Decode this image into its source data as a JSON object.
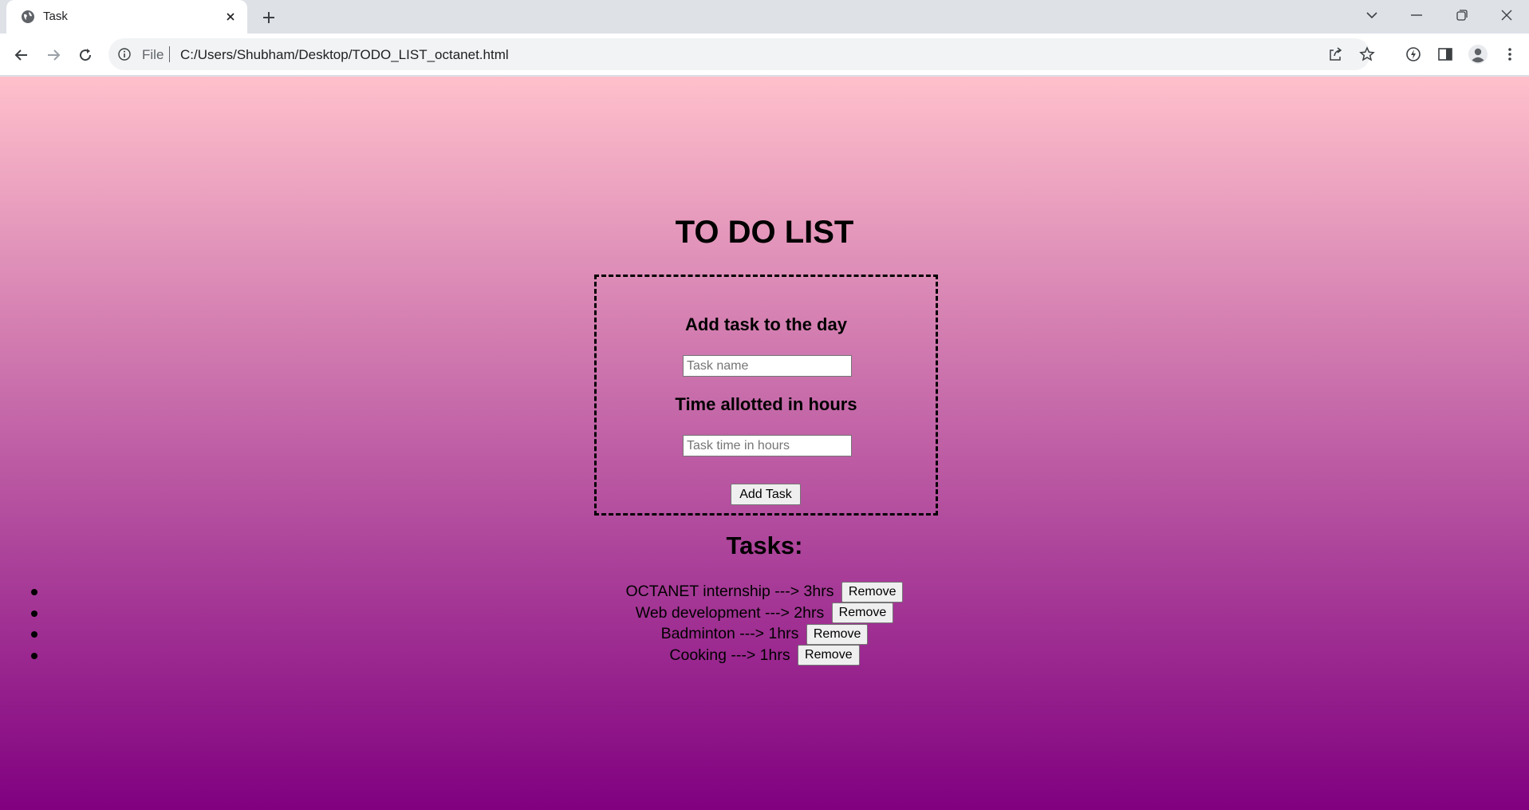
{
  "browser": {
    "tab_title": "Task",
    "address_scheme": "File",
    "address_url": "C:/Users/Shubham/Desktop/TODO_LIST_octanet.html"
  },
  "page": {
    "title": "TO DO LIST",
    "form": {
      "task_label": "Add task to the day",
      "task_placeholder": "Task name",
      "time_label": "Time allotted in hours",
      "time_placeholder": "Task time in hours",
      "add_button": "Add Task"
    },
    "tasks_heading": "Tasks:",
    "tasks": [
      {
        "text": "OCTANET internship ---> 3hrs",
        "remove": "Remove"
      },
      {
        "text": "Web development ---> 2hrs",
        "remove": "Remove"
      },
      {
        "text": "Badminton ---> 1hrs",
        "remove": "Remove"
      },
      {
        "text": "Cooking ---> 1hrs",
        "remove": "Remove"
      }
    ]
  },
  "colors": {
    "gradient_top": "#ffc0cb",
    "gradient_bottom": "#800080"
  }
}
